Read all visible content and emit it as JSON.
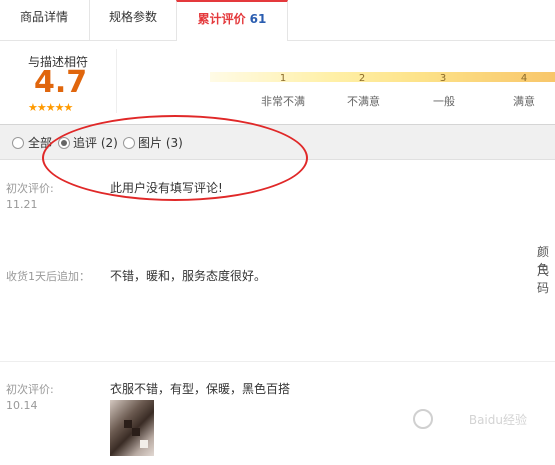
{
  "tabs": [
    {
      "label": "商品详情"
    },
    {
      "label": "规格参数"
    },
    {
      "label": "累计评价",
      "count": "61"
    }
  ],
  "score": {
    "label": "与描述相符",
    "value": "4.7",
    "stars": "★★★★★",
    "scale_numbers": [
      "1",
      "2",
      "3",
      "4"
    ],
    "scale_labels": [
      "非常不满",
      "不满意",
      "一般",
      "满意"
    ]
  },
  "filters": [
    {
      "label": "全部",
      "selected": false
    },
    {
      "label": "追评 (2)",
      "selected": true
    },
    {
      "label": "图片 (3)",
      "selected": false
    }
  ],
  "reviews": [
    {
      "label": "初次评价:",
      "date": "11.21",
      "text": "此用户没有填写评论!"
    },
    {
      "label": "收货1天后追加：",
      "text": "不错，暖和，服务态度很好。"
    },
    {
      "label": "初次评价:",
      "date": "10.14",
      "text": "衣服不错，有型，保暖，黑色百搭"
    }
  ],
  "side_text": [
    "颜色",
    "尺码"
  ],
  "watermark": "Baidu经验",
  "colors": {
    "accent": "#e4393c",
    "score": "#e0660d",
    "star": "#ff9a00",
    "annotation": "#e02828"
  }
}
